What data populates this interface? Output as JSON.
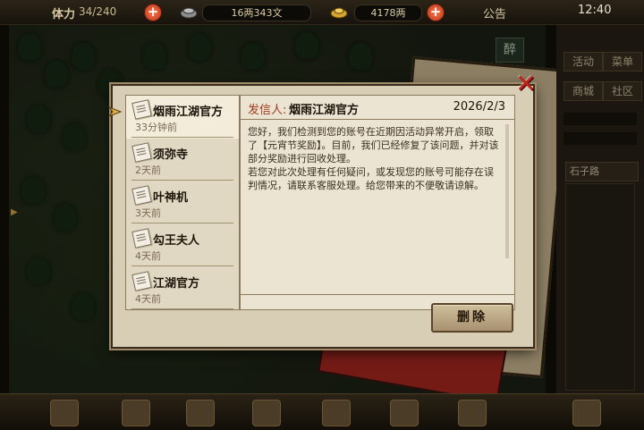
{
  "status_bar": {
    "stamina_label": "体力",
    "stamina_value": "34/240",
    "silver_value": "16两343文",
    "gold_value": "4178两",
    "announcement_label": "公告",
    "time": "12:40"
  },
  "side_panel": {
    "badge": "醉",
    "buttons": [
      "活动",
      "菜单",
      "商城",
      "社区"
    ],
    "location_name": "石子路"
  },
  "mail_list": [
    {
      "sender": "烟雨江湖官方",
      "ago": "33分钟前",
      "selected": true
    },
    {
      "sender": "须弥寺",
      "ago": "2天前",
      "selected": false
    },
    {
      "sender": "叶神机",
      "ago": "3天前",
      "selected": false
    },
    {
      "sender": "勾王夫人",
      "ago": "4天前",
      "selected": false
    },
    {
      "sender": "江湖官方",
      "ago": "4天前",
      "selected": false
    }
  ],
  "mail_detail": {
    "from_label": "发信人:",
    "from_name": "烟雨江湖官方",
    "date": "2026/2/3",
    "body": "您好，我们检测到您的账号在近期因活动异常开启，领取了【元宵节奖励】。目前，我们已经修复了该问题，并对该部分奖励进行回收处理。\n若您对此次处理有任何疑问，或发现您的账号可能存在误判情况，请联系客服处理。给您带来的不便敬请谅解。",
    "delete_label": "删除"
  },
  "colors": {
    "paper": "#d8cdb5",
    "accent_red": "#c2241a",
    "from_label": "#9e3a1f"
  }
}
